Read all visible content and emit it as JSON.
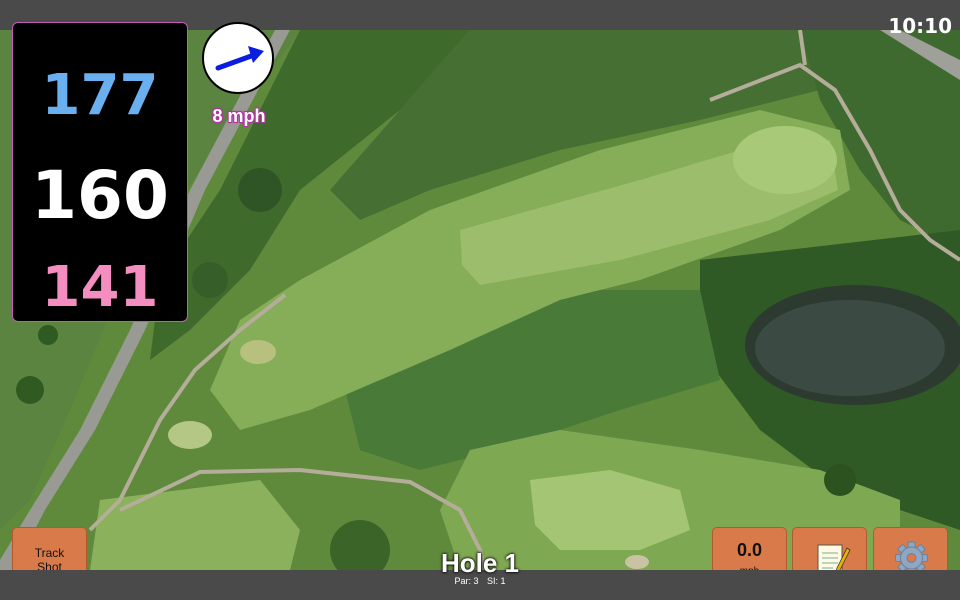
{
  "status": {
    "time": "10:10"
  },
  "yardage": {
    "back": "177",
    "middle": "160",
    "front": "141"
  },
  "wind": {
    "speed": "8 mph",
    "icon": "wind-direction-arrow-icon"
  },
  "buttons": {
    "track_shot_line1": "Track",
    "track_shot_line2": "Shot",
    "speed_value": "0.0",
    "speed_unit": "mph",
    "notes_icon": "notepad-icon",
    "settings_icon": "gear-icon"
  },
  "hole": {
    "title": "Hole 1",
    "par": "Par: 3",
    "si": "SI: 1"
  },
  "colors": {
    "back": "#6ab0f0",
    "middle": "#ffffff",
    "front": "#f58ec0",
    "button": "#d87a4a",
    "wind_outline": "#b0329e"
  }
}
